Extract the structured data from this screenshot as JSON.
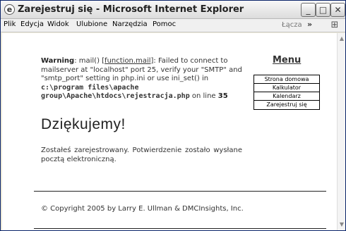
{
  "window": {
    "title": "Zarejestruj się - Microsoft Internet Explorer",
    "buttons": {
      "minimize": "_",
      "maximize": "□",
      "close": "✕"
    }
  },
  "menubar": {
    "items": [
      "Plik",
      "Edycja",
      "Widok",
      "Ulubione",
      "Narzędzia",
      "Pomoc"
    ],
    "links_label": "Łącza",
    "chevron": "»"
  },
  "warning": {
    "label": "Warning",
    "text1": ": mail() [",
    "link": "function.mail",
    "text2": "]: Failed to connect to mailserver at \"localhost\" port 25, verify your \"SMTP\" and \"smtp_port\" setting in php.ini or use ini_set() in ",
    "path": "c:\\program files\\apache group\\Apache\\htdocs\\rejestracja.php",
    "line_text": " on line ",
    "line_number": "35"
  },
  "content": {
    "heading": "Dziękujemy!",
    "message": "Zostałeś zarejestrowany. Potwierdzenie zostało wysłane pocztą elektroniczną."
  },
  "sidebar": {
    "title": "Menu",
    "items": [
      "Strona domowa",
      "Kalkulator",
      "Kalendarz",
      "Zarejestruj się"
    ]
  },
  "footer": {
    "text": "© Copyright 2005 by Larry E. Ullman & DMCInsights, Inc."
  }
}
